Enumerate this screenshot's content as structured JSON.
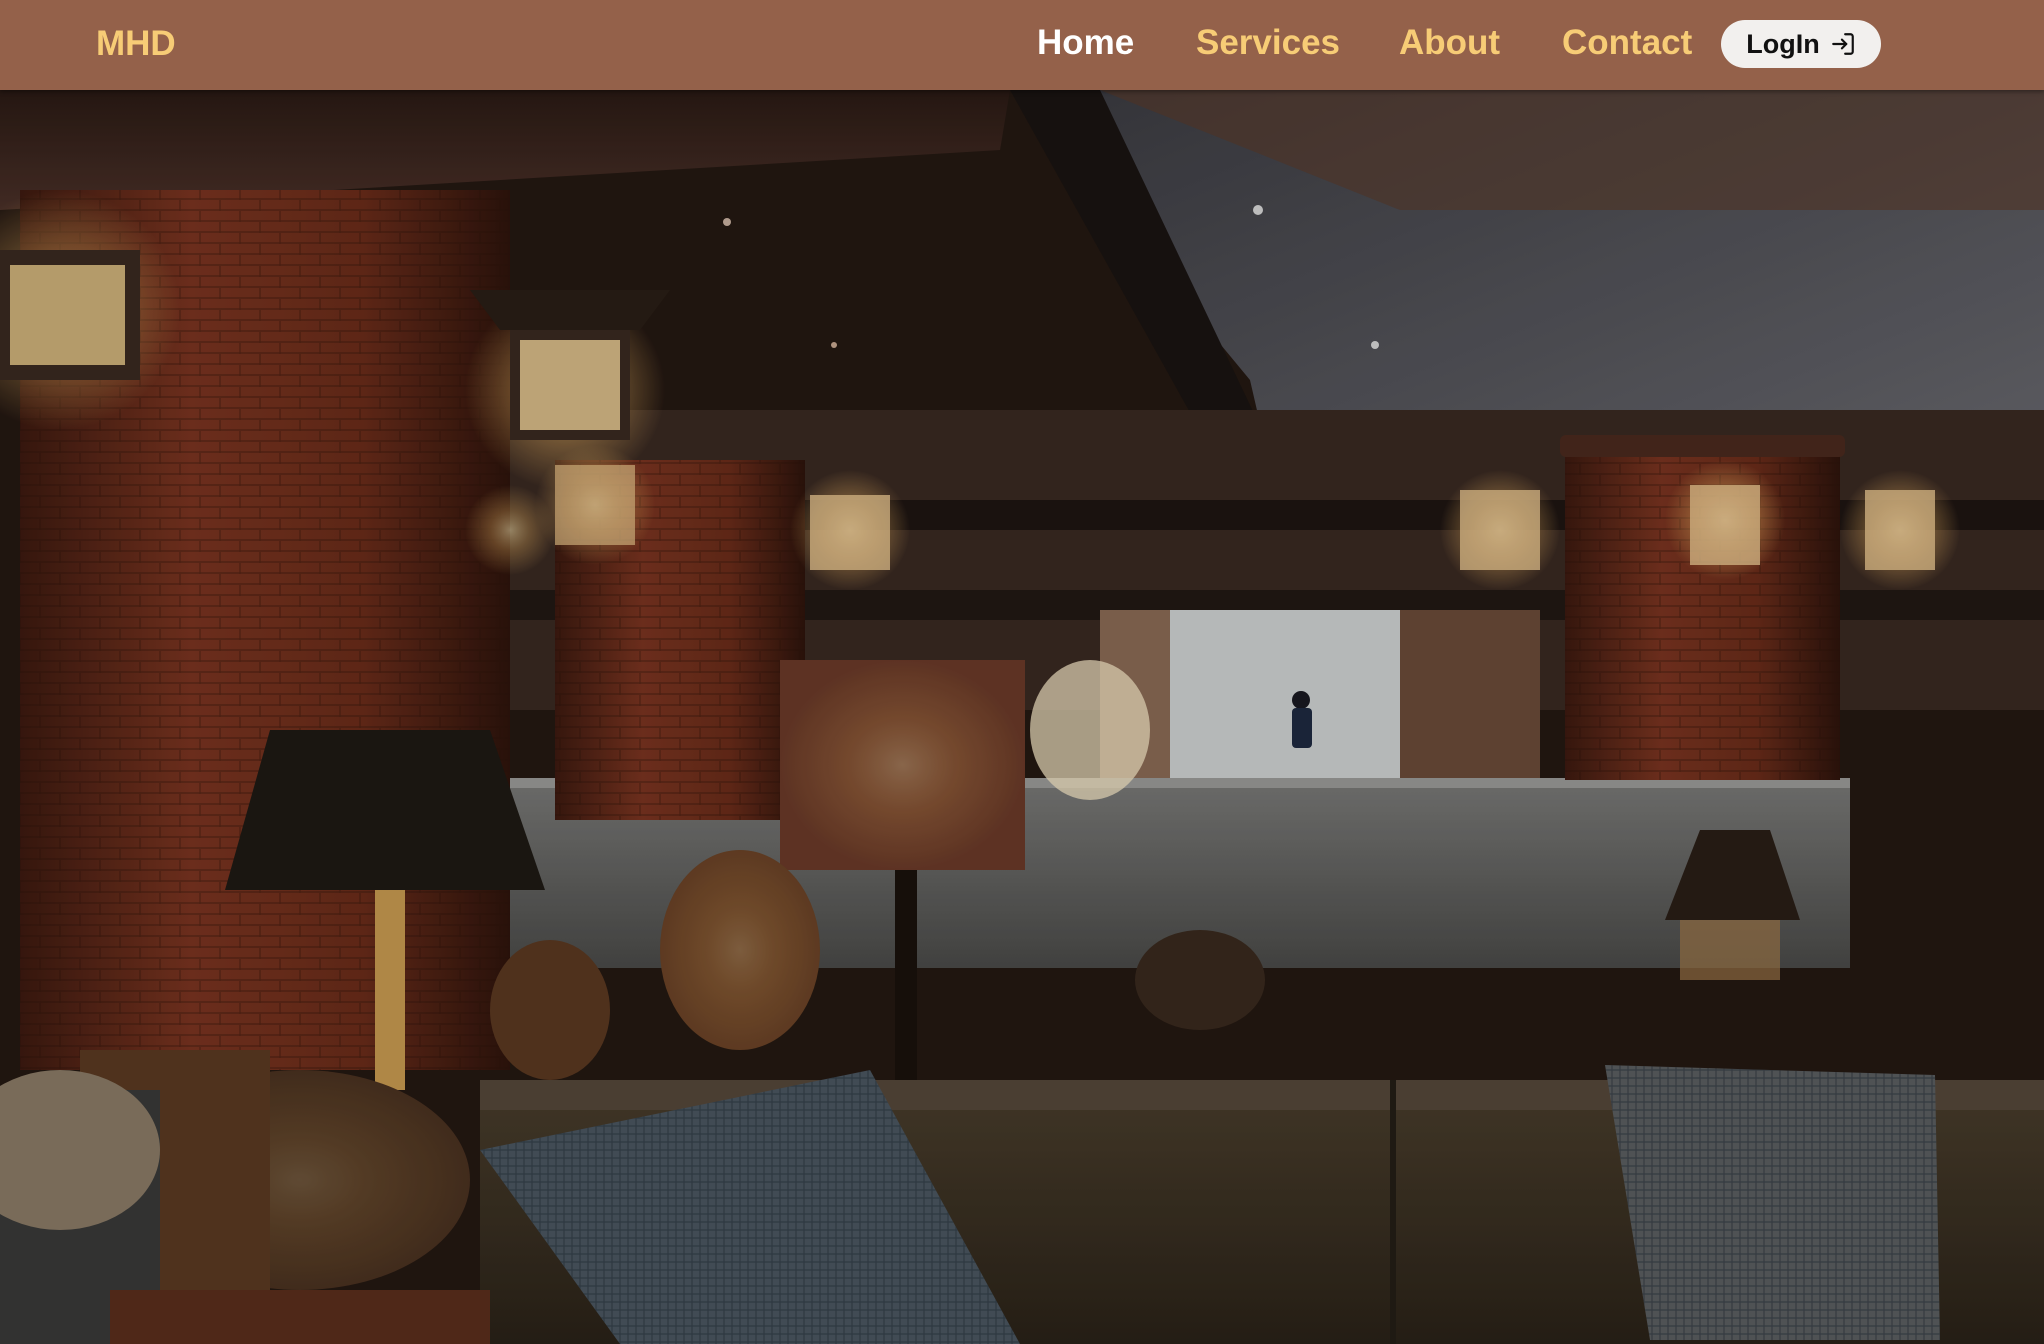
{
  "header": {
    "brand": "MHD",
    "nav": [
      {
        "label": "Home",
        "active": true
      },
      {
        "label": "Services",
        "active": false
      },
      {
        "label": "About",
        "active": false
      },
      {
        "label": "Contact",
        "active": false
      }
    ],
    "login_label": "LogIn",
    "login_icon": "login-arrow-icon"
  },
  "hero": {
    "image_subject": "dim hotel lounge interior with brick pillars, hanging lanterns, lamps, baskets and a sofa with cushions"
  },
  "colors": {
    "navbar_bg": "#94614a",
    "brand": "#f7cc76",
    "nav_link": "#f7cc76",
    "nav_active": "#ffffff",
    "login_bg": "#f2f0ee"
  }
}
